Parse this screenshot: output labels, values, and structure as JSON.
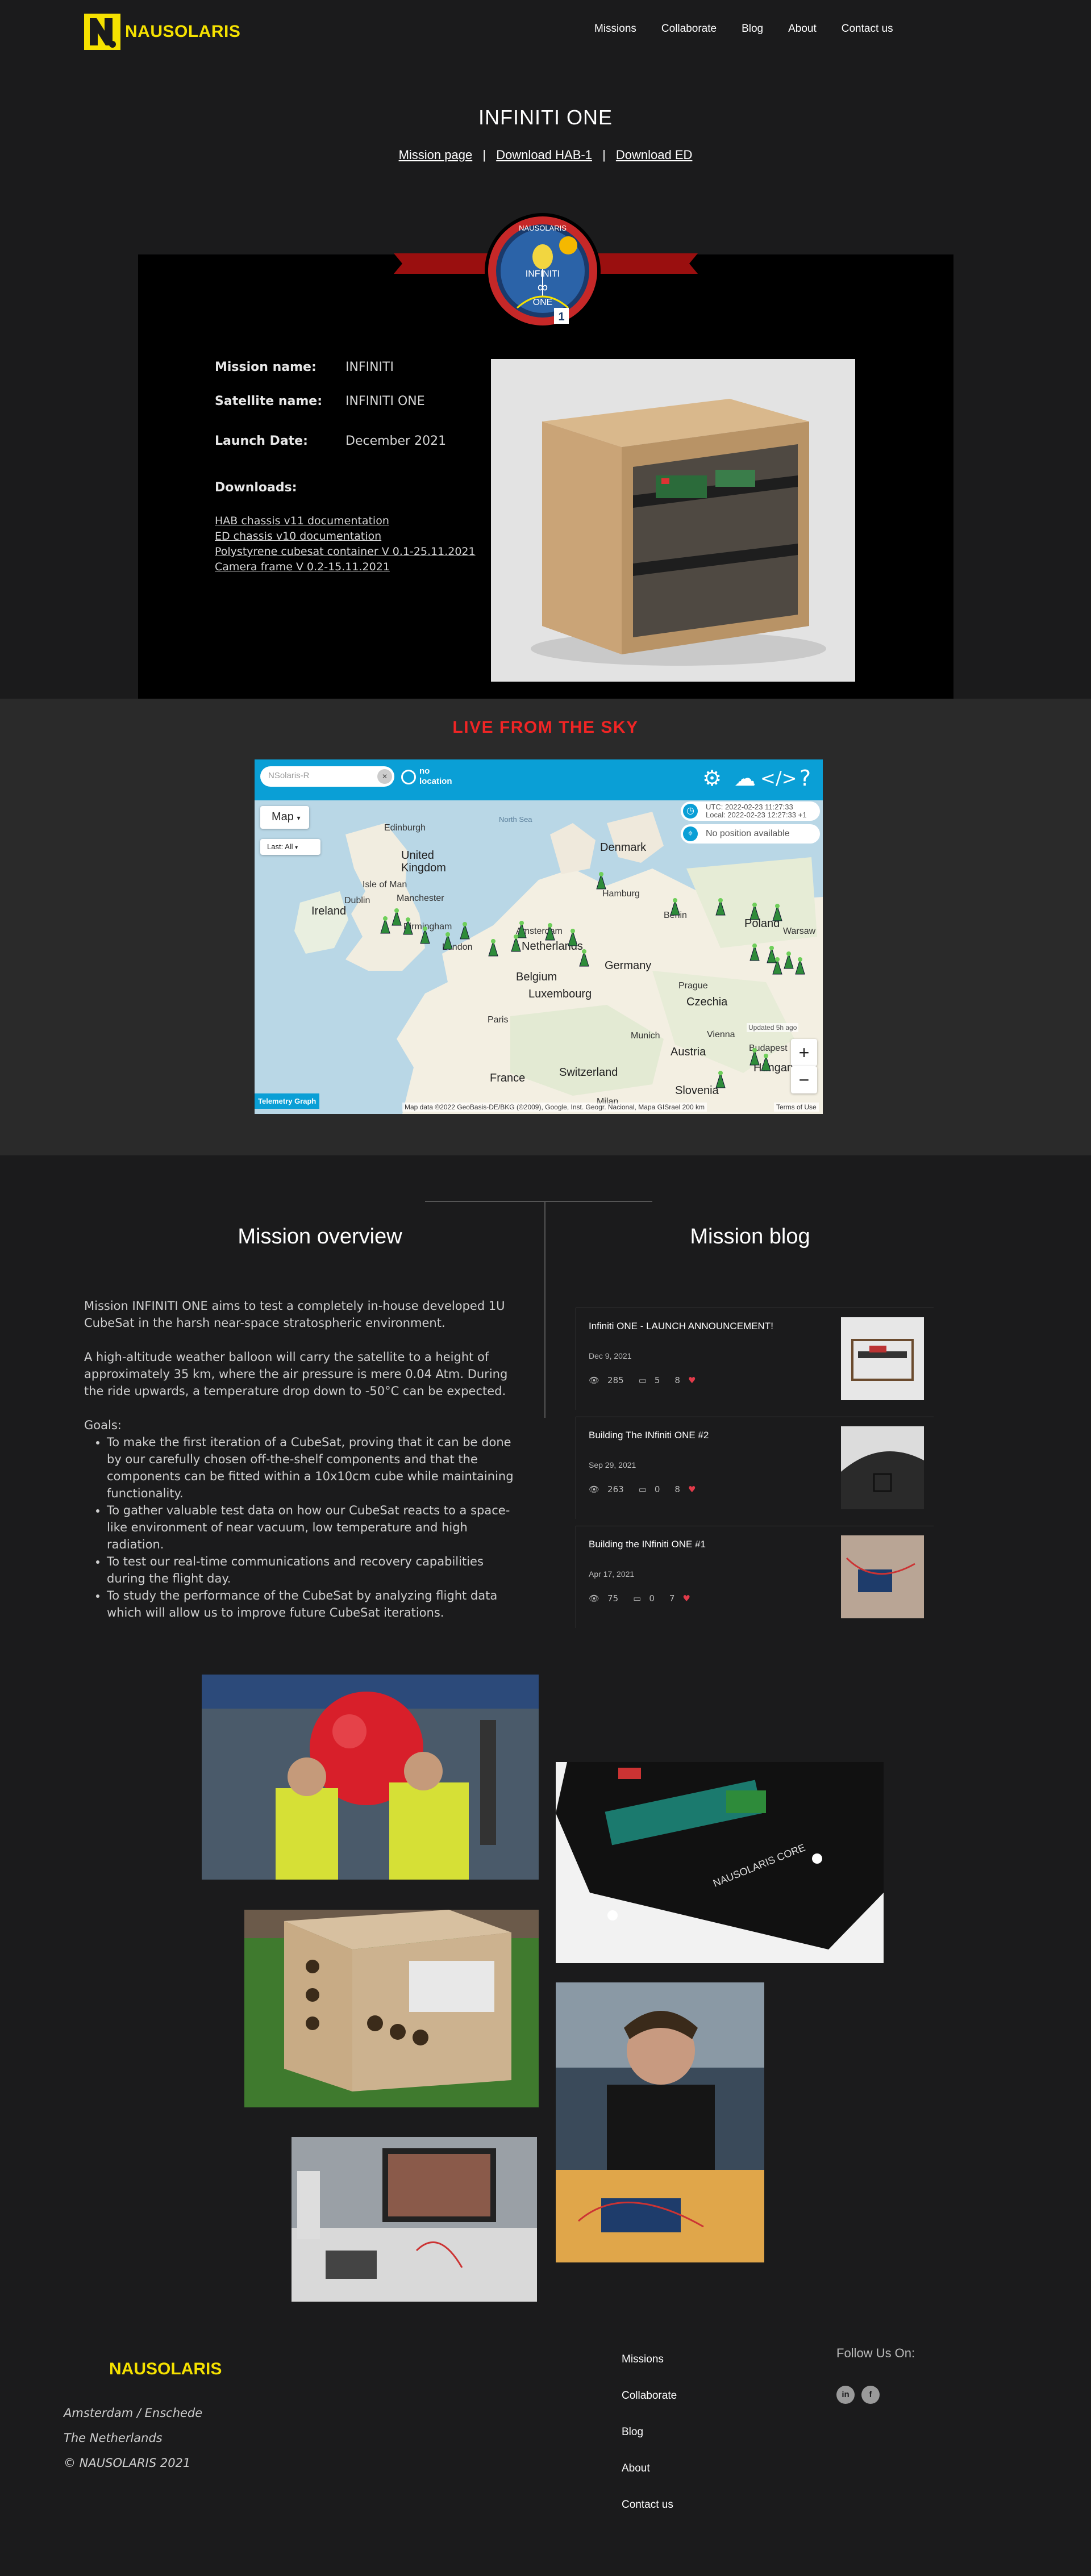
{
  "header": {
    "logo_text": "NAUSOLARIS",
    "nav": [
      "Missions",
      "Collaborate",
      "Blog",
      "About",
      "Contact us"
    ]
  },
  "mission": {
    "title": "INFINITI ONE",
    "links": [
      "Mission page",
      "Download HAB-1",
      "Download ED"
    ],
    "separators": [
      "|",
      "|"
    ],
    "badge": {
      "arc_text": "NAUSOLARIS",
      "line1": "INFINITI",
      "line2": "ONE",
      "number": "1"
    },
    "fields": [
      {
        "label": "Mission name:",
        "value": "INFINITI"
      },
      {
        "label": "Satellite name:",
        "value": "INFINITI ONE"
      },
      {
        "label": "Launch Date:",
        "value": "December 2021"
      }
    ],
    "downloads_label": "Downloads:",
    "downloads": [
      "HAB chassis v11 documentation",
      "ED chassis v10 documentation",
      "Polystyrene cubesat container V 0.1-25.11.2021",
      "Camera frame V 0.2-15.11.2021"
    ]
  },
  "live": {
    "title": "LIVE FROM THE SKY",
    "search_placeholder": "NSolaris-R",
    "search_button": "✕",
    "no_location": "no\nlocation",
    "map_type": "Map",
    "filter": "Last: All",
    "utc": "UTC: 2022-02-23 11:27:33",
    "local": "Local: 2022-02-23 12:27:33 +1",
    "position": "No position available",
    "updated": "Updated 5h ago",
    "zoom_in": "+",
    "zoom_out": "−",
    "telemetry": "Telemetry Graph",
    "attribution": "Map data ©2022 GeoBasis-DE/BKG (©2009), Google, Inst. Geogr. Nacional, Mapa GISrael   200 km",
    "terms": "Terms of Use",
    "seas": [
      "North Sea"
    ],
    "countries": [
      "United\nKingdom",
      "Ireland",
      "Netherlands",
      "Belgium",
      "Luxembourg",
      "Germany",
      "Denmark",
      "Poland",
      "Czechia",
      "France",
      "Switzerland",
      "Austria",
      "Hungary",
      "Slovenia"
    ],
    "cities": [
      "Edinburgh",
      "Isle of Man",
      "Dublin",
      "Manchester",
      "Birmingham",
      "London",
      "Amsterdam",
      "Hamburg",
      "Berlin",
      "Warsaw",
      "Prague",
      "Munich",
      "Vienna",
      "Paris",
      "Milan",
      "Budapest"
    ]
  },
  "overview": {
    "title": "Mission overview",
    "paragraphs": [
      "Mission INFINITI ONE aims to test a completely in-house developed 1U CubeSat in the harsh near-space stratospheric environment.",
      "A high-altitude weather balloon will carry the satellite to a height of approximately 35 km, where the air pressure is mere 0.04 Atm.  During the ride upwards, a temperature drop down to -50°C can be expected."
    ],
    "goals_label": "Goals:",
    "goals": [
      "To make the first iteration of a CubeSat, proving that it can be done by our carefully chosen off-the-shelf components and that the components can be fitted within a 10x10cm cube while maintaining functionality.",
      "To gather valuable test data on how our CubeSat reacts to a space-like environment of near vacuum, low temperature and high radiation.",
      "To test our real-time communications and recovery capabilities during the flight day.",
      "To study the performance of the CubeSat by analyzing flight data which will allow us to improve future CubeSat iterations."
    ]
  },
  "blog": {
    "title": "Mission blog",
    "posts": [
      {
        "title": "Infiniti ONE - LAUNCH ANNOUNCEMENT!",
        "date": "Dec 9, 2021",
        "views": "285",
        "comments": "5",
        "likes": "8"
      },
      {
        "title": "Building The INfiniti ONE #2",
        "date": "Sep 29, 2021",
        "views": "263",
        "comments": "0",
        "likes": "8"
      },
      {
        "title": "Building the INfiniti ONE #1",
        "date": "Apr 17, 2021",
        "views": "75",
        "comments": "0",
        "likes": "7"
      }
    ]
  },
  "gallery": {
    "pcb_text": "NAUSOLARIS CORE"
  },
  "footer": {
    "logo_text": "NAUSOLARIS",
    "address": [
      "Amsterdam / Enschede",
      "The Netherlands",
      "© NAUSOLARIS 2021"
    ],
    "links": [
      "Missions",
      "Collaborate",
      "Blog",
      "About",
      "Contact us"
    ],
    "follow": "Follow Us On:",
    "social": [
      "in",
      "f"
    ]
  },
  "colors": {
    "accent_yellow": "#f5e100",
    "live_red": "#f02525",
    "map_blue": "#0a9fd6",
    "heart": "#e23b4a"
  }
}
